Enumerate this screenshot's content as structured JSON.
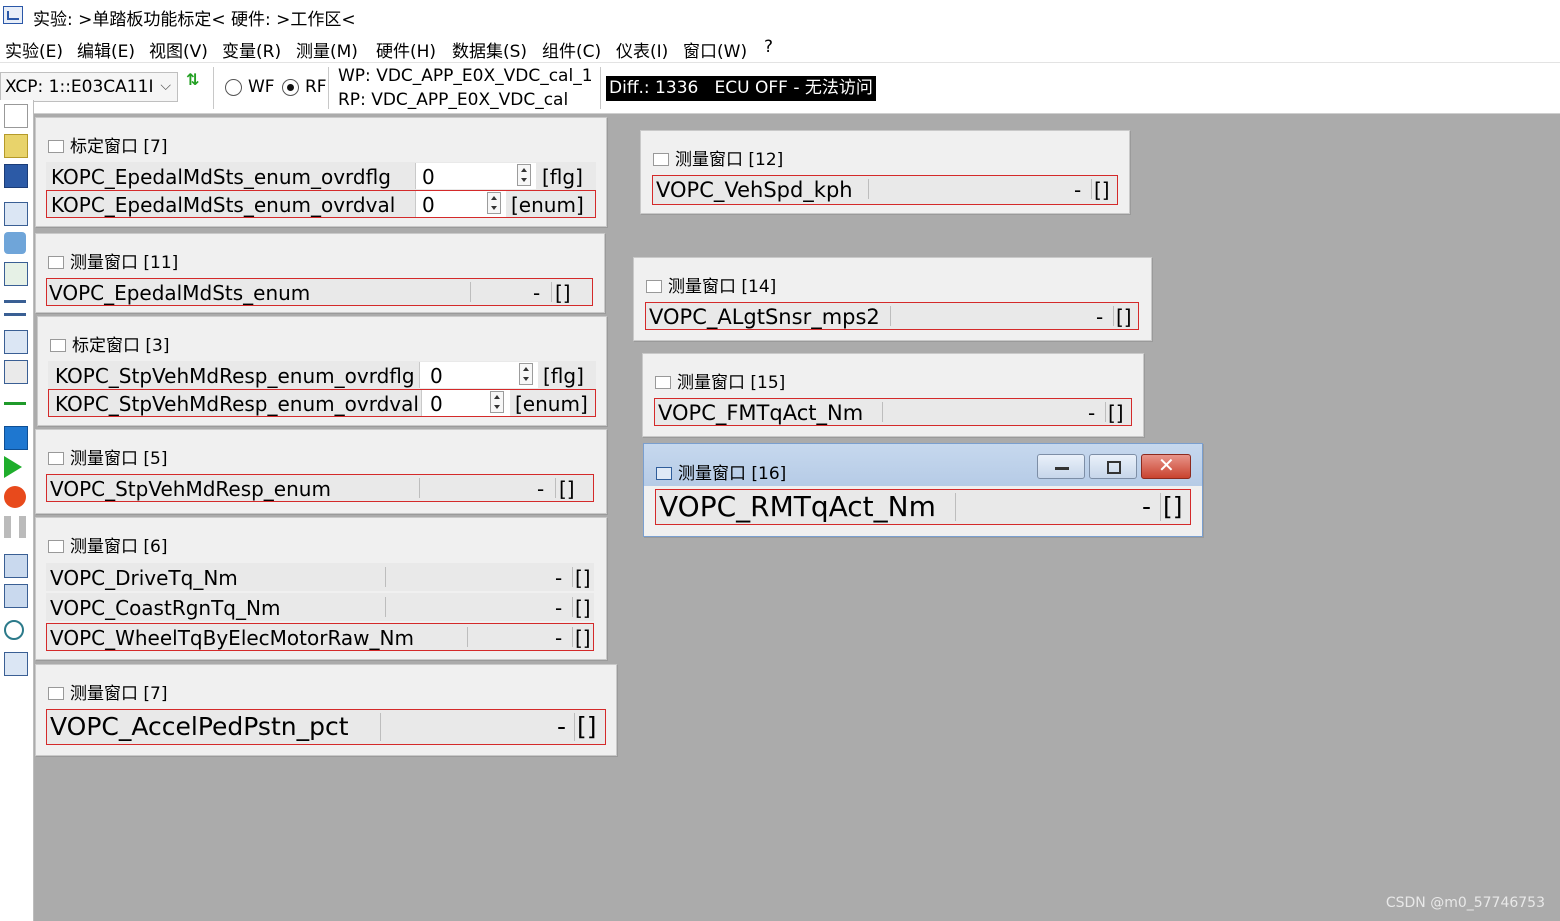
{
  "title": "实验: >单踏板功能标定< 硬件: >工作区<",
  "menu": [
    "实验(E)",
    "编辑(E)",
    "视图(V)",
    "变量(R)",
    "测量(M)",
    "硬件(H)",
    "数据集(S)",
    "组件(C)",
    "仪表(I)",
    "窗口(W)",
    "?"
  ],
  "toolbar": {
    "device": "XCP: 1::E03CA11I",
    "radio_wp": "WF",
    "radio_rp": "RF",
    "wp": "WP: VDC_APP_E0X_VDC_cal_1",
    "rp": "RP: VDC_APP_E0X_VDC_cal",
    "diff": "Diff.: 1336   ECU OFF - 无法访问"
  },
  "windows": {
    "cal7": {
      "title": "标定窗口 [7]",
      "rows": [
        {
          "name": "KOPC_EpedalMdSts_enum_ovrdflg",
          "value": "0",
          "unit": "[flg]"
        },
        {
          "name": "KOPC_EpedalMdSts_enum_ovrdval",
          "value": "0",
          "unit": "[enum]"
        }
      ]
    },
    "m11": {
      "title": "测量窗口 [11]",
      "rows": [
        {
          "name": "VOPC_EpedalMdSts_enum",
          "value": "-",
          "unit": "[]"
        }
      ]
    },
    "cal3": {
      "title": "标定窗口 [3]",
      "rows": [
        {
          "name": "KOPC_StpVehMdResp_enum_ovrdflg",
          "value": "0",
          "unit": "[flg]"
        },
        {
          "name": "KOPC_StpVehMdResp_enum_ovrdval",
          "value": "0",
          "unit": "[enum]"
        }
      ]
    },
    "m5": {
      "title": "测量窗口 [5]",
      "rows": [
        {
          "name": "VOPC_StpVehMdResp_enum",
          "value": "-",
          "unit": "[]"
        }
      ]
    },
    "m6": {
      "title": "测量窗口 [6]",
      "rows": [
        {
          "name": "VOPC_DriveTq_Nm",
          "value": "-",
          "unit": "[]"
        },
        {
          "name": "VOPC_CoastRgnTq_Nm",
          "value": "-",
          "unit": "[]"
        },
        {
          "name": "VOPC_WheelTqByElecMotorRaw_Nm",
          "value": "-",
          "unit": "[]"
        }
      ]
    },
    "m7": {
      "title": "测量窗口 [7]",
      "rows": [
        {
          "name": "VOPC_AccelPedPstn_pct",
          "value": "-",
          "unit": "[]"
        }
      ]
    },
    "m12": {
      "title": "测量窗口 [12]",
      "rows": [
        {
          "name": "VOPC_VehSpd_kph",
          "value": "-",
          "unit": "[]"
        }
      ]
    },
    "m14": {
      "title": "测量窗口 [14]",
      "rows": [
        {
          "name": "VOPC_ALgtSnsr_mps2",
          "value": "-",
          "unit": "[]"
        }
      ]
    },
    "m15": {
      "title": "测量窗口 [15]",
      "rows": [
        {
          "name": "VOPC_FMTqAct_Nm",
          "value": "-",
          "unit": "[]"
        }
      ]
    },
    "m16": {
      "title": "测量窗口 [16]",
      "rows": [
        {
          "name": "VOPC_RMTqAct_Nm",
          "value": "-",
          "unit": "[]"
        }
      ]
    }
  },
  "watermark": "CSDN @m0_57746753",
  "colors": {
    "background": "#ababab",
    "selection_border": "#d42a2a",
    "diff_bg": "#000000"
  }
}
